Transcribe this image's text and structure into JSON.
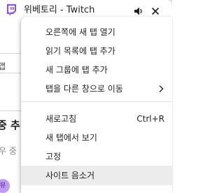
{
  "browser": {
    "tab": {
      "title": "위베토리 - Twitch",
      "favicon": "twitch-icon",
      "audio_icon": "speaker-icon",
      "close_icon": "close-icon"
    },
    "page_fragments": [
      "앱",
      "중 추",
      "우 중",
      "뮤"
    ]
  },
  "context_menu": {
    "groups": [
      {
        "items": [
          {
            "label": "오른쪽에 새 탭 열기"
          },
          {
            "label": "읽기 목록에 탭 추가"
          },
          {
            "label": "새 그룹에 탭 추가"
          },
          {
            "label": "탭을 다른 창으로 이동",
            "submenu_icon": "chevron-right-icon"
          }
        ]
      },
      {
        "items": [
          {
            "label": "새로고침",
            "shortcut": "Ctrl+R"
          },
          {
            "label": "새 탭에서 보기"
          },
          {
            "label": "고정"
          },
          {
            "label": "사이트 음소거",
            "hovered": true
          }
        ]
      }
    ]
  },
  "colors": {
    "twitch_purple": "#9146ff",
    "menu_hover": "#ececec",
    "tab_strip": "#dfe3e8"
  }
}
